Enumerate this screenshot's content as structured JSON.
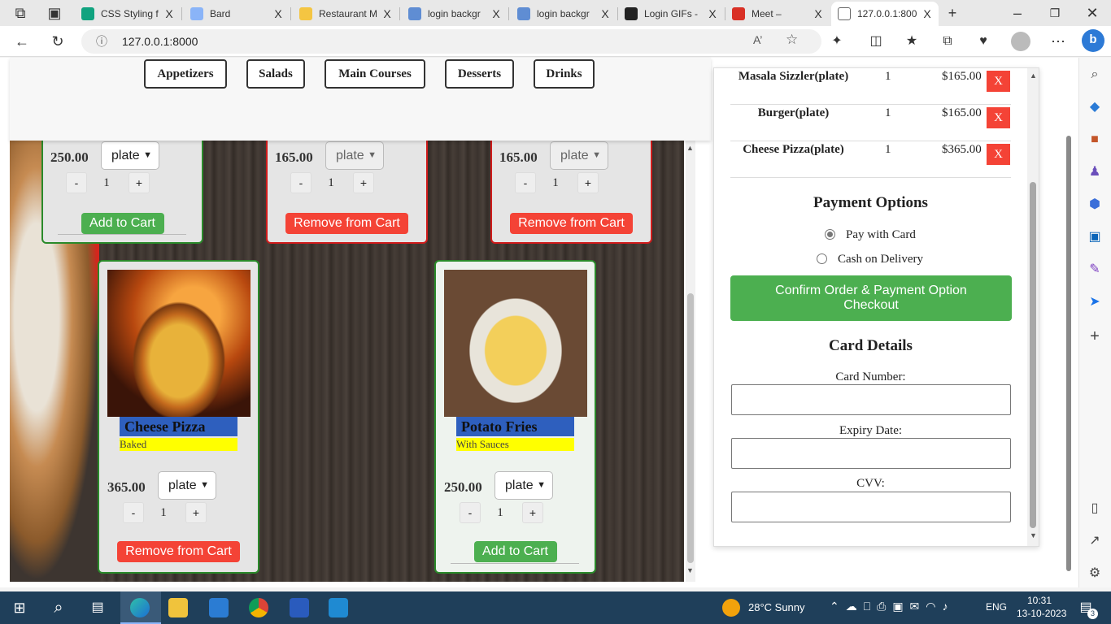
{
  "browser": {
    "tabs": [
      {
        "title": "CSS Styling f",
        "fav": "#10a37f",
        "active": false
      },
      {
        "title": "Bard",
        "fav": "#8ab4f8",
        "active": false
      },
      {
        "title": "Restaurant M",
        "fav": "#f4c542",
        "active": false
      },
      {
        "title": "login backgr",
        "fav": "#5f8dd3",
        "active": false
      },
      {
        "title": "login backgr",
        "fav": "#5f8dd3",
        "active": false
      },
      {
        "title": "Login GIFs -",
        "fav": "#222222",
        "active": false
      },
      {
        "title": "Meet –",
        "fav": "#d93025",
        "active": false
      },
      {
        "title": "127.0.0.1:800",
        "fav": "#ffffff",
        "active": true
      }
    ],
    "close_glyph": "X",
    "new_tab_glyph": "+",
    "url": "127.0.0.1:8000",
    "icons": [
      "back-icon",
      "reload-icon",
      "info-icon",
      "read-aloud-icon",
      "favorite-star-icon",
      "extensions-icon",
      "split-screen-icon",
      "favorites-icon",
      "collections-icon",
      "browser-essentials-icon",
      "profile-icon",
      "more-icon",
      "bing-icon"
    ]
  },
  "menu": {
    "categories": [
      "Appetizers",
      "Salads",
      "Main Courses",
      "Desserts",
      "Drinks"
    ]
  },
  "cards_top": [
    {
      "price": "250.00",
      "unit": "plate",
      "qty": "1",
      "action": "Add to Cart",
      "type": "add"
    },
    {
      "price": "165.00",
      "unit": "plate",
      "qty": "1",
      "action": "Remove from Cart",
      "type": "rem"
    },
    {
      "price": "165.00",
      "unit": "plate",
      "qty": "1",
      "action": "Remove from Cart",
      "type": "rem"
    }
  ],
  "cards_bottom": [
    {
      "name": "Cheese Pizza",
      "desc": "Baked",
      "price": "365.00",
      "unit": "plate",
      "qty": "1",
      "action": "Remove from Cart",
      "type": "rem"
    },
    {
      "name": "Potato Fries",
      "desc": "With Sauces",
      "price": "250.00",
      "unit": "plate",
      "qty": "1",
      "action": "Add to Cart",
      "type": "add"
    }
  ],
  "qty_minus": "-",
  "qty_plus": "+",
  "cart": {
    "items": [
      {
        "name": "Masala Sizzler(plate)",
        "qty": "1",
        "price": "$165.00"
      },
      {
        "name": "Burger(plate)",
        "qty": "1",
        "price": "$165.00"
      },
      {
        "name": "Cheese Pizza(plate)",
        "qty": "1",
        "price": "$365.00"
      }
    ],
    "remove_label": "X",
    "payment_title": "Payment Options",
    "pay_card": "Pay with Card",
    "pay_cash": "Cash on Delivery",
    "confirm_line1": "Confirm Order & Payment Option",
    "confirm_line2": "Checkout",
    "card_details_title": "Card Details",
    "card_number_label": "Card Number:",
    "expiry_label": "Expiry Date:",
    "cvv_label": "CVV:"
  },
  "taskbar": {
    "weather": "28°C  Sunny",
    "lang": "ENG",
    "time": "10:31",
    "date": "13-10-2023",
    "notifications": "3"
  }
}
